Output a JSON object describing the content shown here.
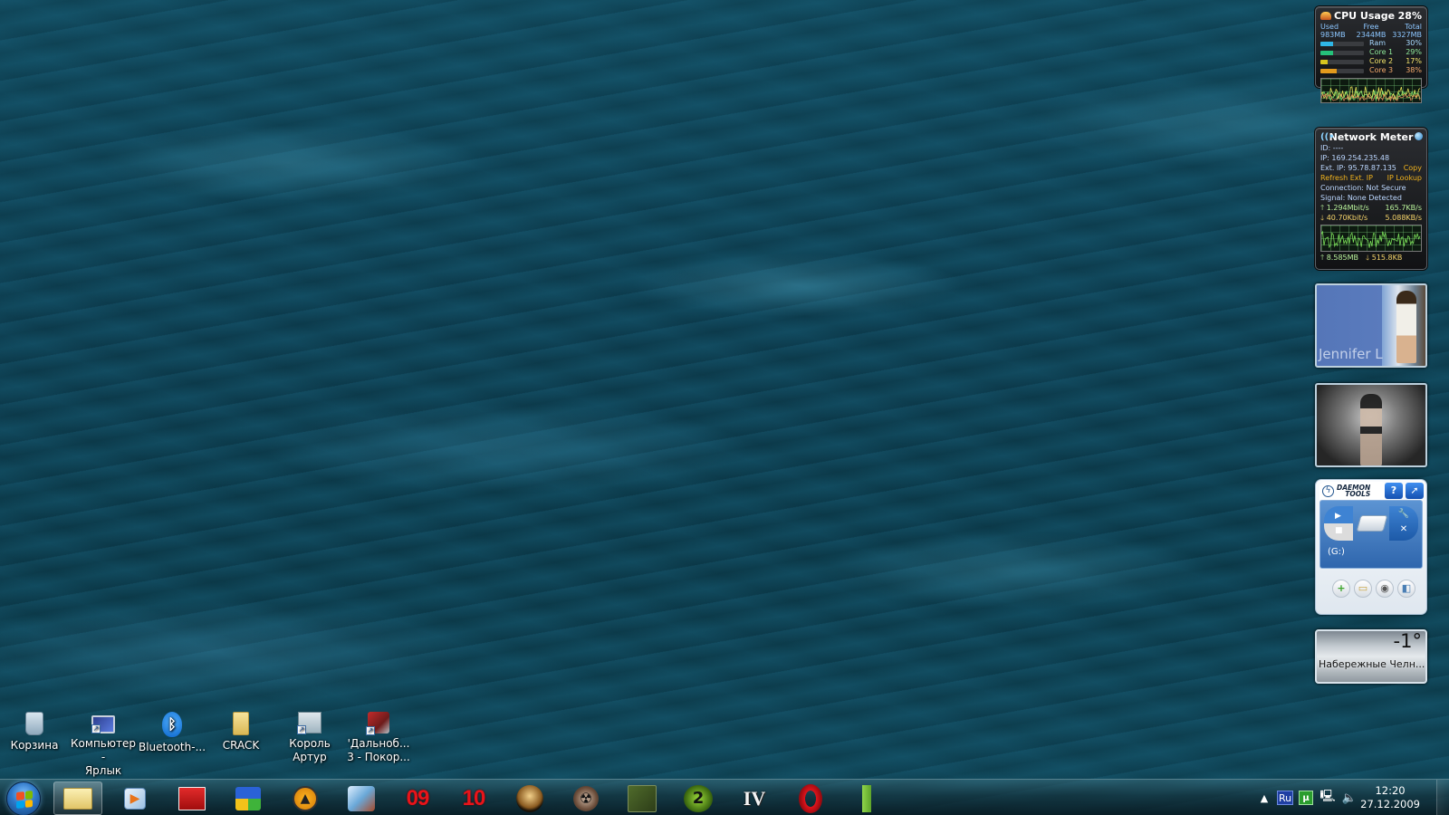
{
  "desktop": {
    "icons": [
      {
        "label": "Корзина",
        "icon": "recycle-bin-icon"
      },
      {
        "label": "Компьютер - Ярлык",
        "line1": "Компьютер -",
        "line2": "Ярлык",
        "icon": "computer-shortcut-icon"
      },
      {
        "label": "Bluetooth-...",
        "icon": "bluetooth-icon"
      },
      {
        "label": "CRACK",
        "icon": "folder-icon"
      },
      {
        "label": "Король Артур",
        "line1": "Король",
        "line2": "Артур",
        "icon": "king-arthur-shortcut-icon"
      },
      {
        "label": "'Дальнобойщики 3 - Покор...",
        "line1": "'Дальноб...",
        "line2": "3 - Покор...",
        "icon": "truck-game-shortcut-icon"
      }
    ]
  },
  "gadgets": {
    "cpu": {
      "title": "CPU Usage",
      "percent": "28%",
      "headers": [
        "Used",
        "Free",
        "Total"
      ],
      "values": [
        "983MB",
        "2344MB",
        "3327MB"
      ],
      "meters": [
        {
          "name": "Ram",
          "value": "30%",
          "fraction": 0.3,
          "color": "#2fb6e6",
          "text_color": "#a7d9ff"
        },
        {
          "name": "Core 1",
          "value": "29%",
          "fraction": 0.29,
          "color": "#25c27a",
          "text_color": "#8fe89a"
        },
        {
          "name": "Core 2",
          "value": "17%",
          "fraction": 0.17,
          "color": "#d8c51e",
          "text_color": "#f1e36a"
        },
        {
          "name": "Core 3",
          "value": "38%",
          "fraction": 0.38,
          "color": "#e39a1d",
          "text_color": "#f3a96b"
        }
      ]
    },
    "network": {
      "title": "Network Meter",
      "id": "ID: ----",
      "ip": "IP: 169.254.235.48",
      "ext_ip": "Ext. IP: 95.78.87.135",
      "copy": "Copy",
      "refresh": "Refresh Ext. IP",
      "lookup": "IP Lookup",
      "connection": "Connection: Not Secure",
      "signal": "Signal:  None Detected",
      "up_rate": "1.294Mbit/s",
      "up_bytes": "165.7KB/s",
      "down_rate": "40.70Kbit/s",
      "down_bytes": "5.088KB/s",
      "total_up": "8.585MB",
      "total_down": "515.8KB"
    },
    "photo1": {
      "caption": "Jennifer L"
    },
    "daemon": {
      "brand_line1": "DAEMON",
      "brand_line2": "TOOLS",
      "help": "?",
      "drive": "(G:)"
    },
    "weather": {
      "temperature": "-1°",
      "city": "Набережные Челн..."
    }
  },
  "taskbar": {
    "pinned": [
      {
        "name": "windows-explorer",
        "active": true
      },
      {
        "name": "windows-media-player"
      },
      {
        "name": "red-app"
      },
      {
        "name": "cubes-app"
      },
      {
        "name": "aimp"
      },
      {
        "name": "motocross-game"
      },
      {
        "name": "game-09",
        "text": "09"
      },
      {
        "name": "game-10",
        "text": "10"
      },
      {
        "name": "portrait-game"
      },
      {
        "name": "radiation-game"
      },
      {
        "name": "soldier-game"
      },
      {
        "name": "half-life-2",
        "text": "2"
      },
      {
        "name": "gta-iv",
        "text": "IV"
      },
      {
        "name": "opera-browser"
      },
      {
        "name": "drink-app"
      }
    ],
    "tray": {
      "language": "Ru",
      "time": "12:20",
      "date": "27.12.2009"
    }
  }
}
